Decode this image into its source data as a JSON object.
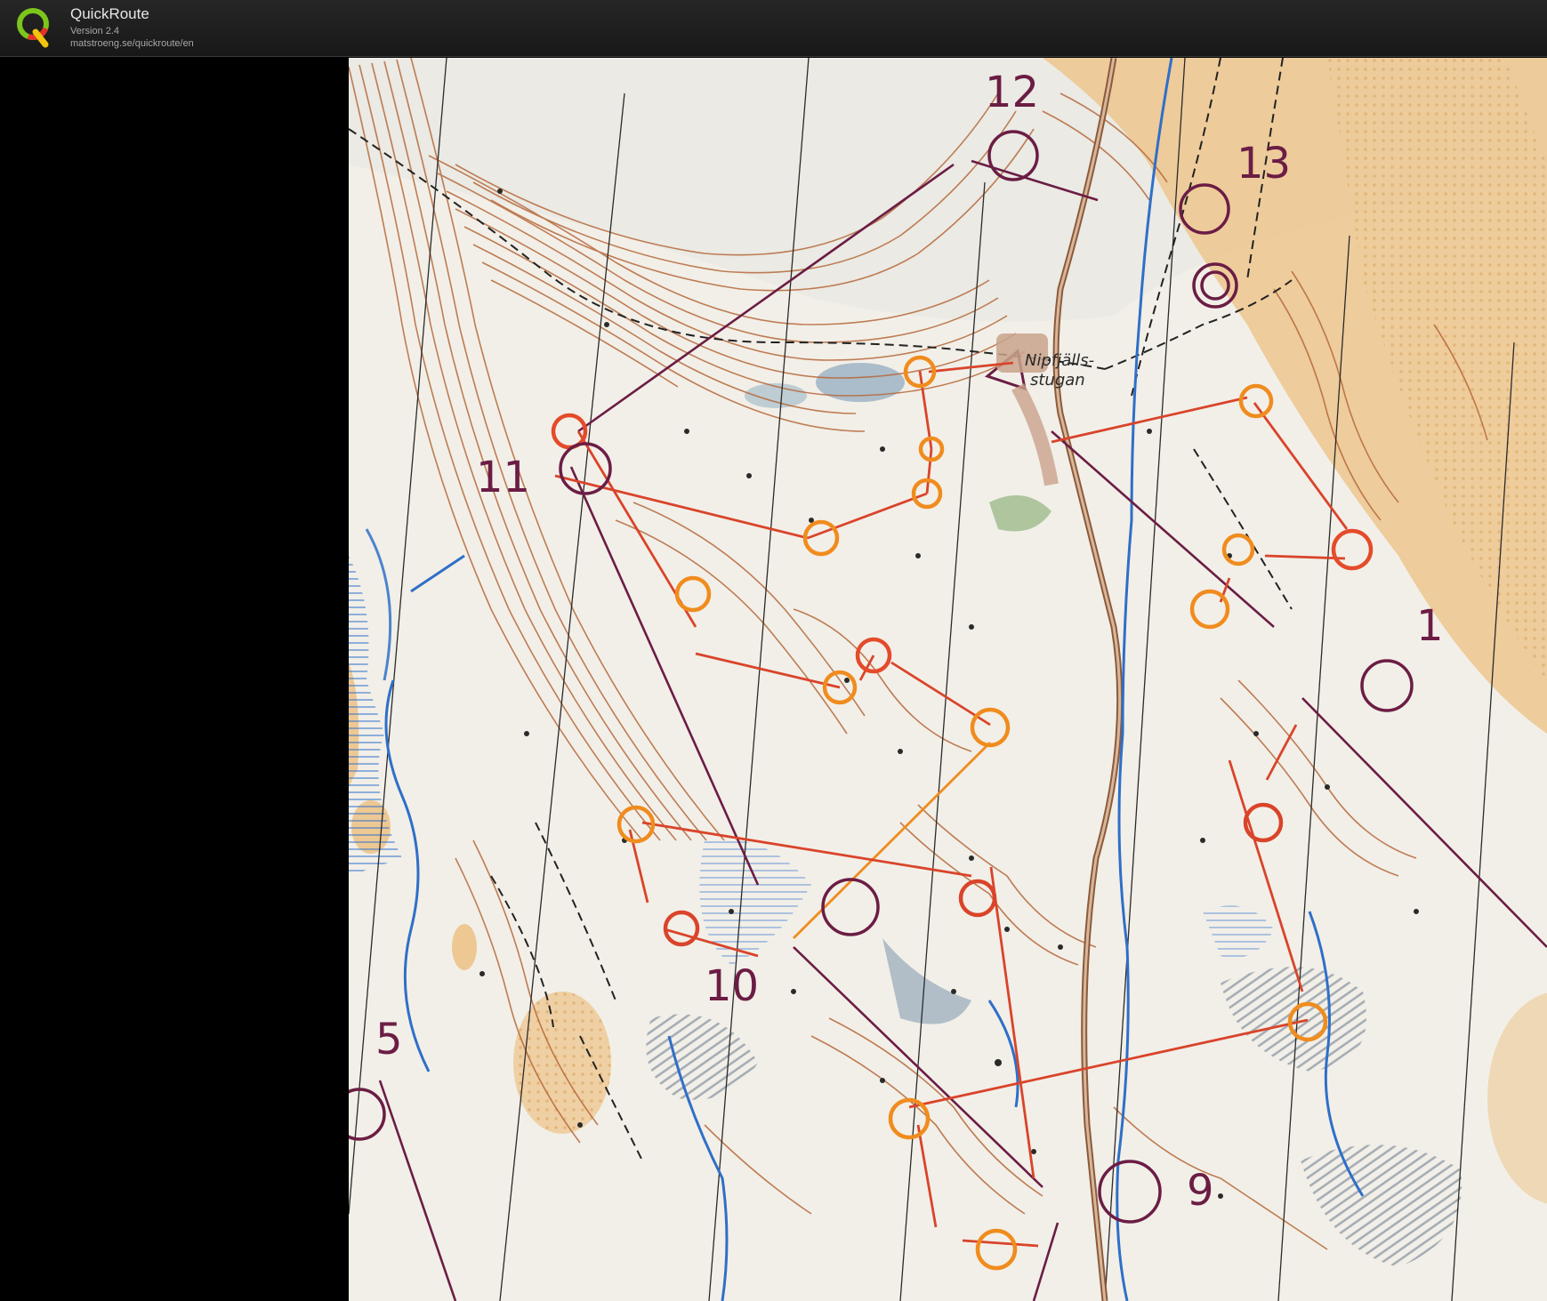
{
  "app": {
    "name": "QuickRoute",
    "version": "Version 2.4",
    "url": "matstroeng.se/quickroute/en"
  },
  "map": {
    "control_numbers": [
      "12",
      "13",
      "11",
      "1",
      "10",
      "5",
      "9"
    ],
    "place_name_line1": "Nipfjälls-",
    "place_name_line2": "stugan"
  },
  "colors": {
    "header_bg": "#1f1f1f",
    "panel_bg": "#000000",
    "course_purple": "#6b1d44",
    "route_red": "#d9442a",
    "route_orange": "#f08c1e",
    "contour_brown": "#b5683a",
    "water_blue": "#2f6fc8",
    "open_land": "#eec891"
  }
}
